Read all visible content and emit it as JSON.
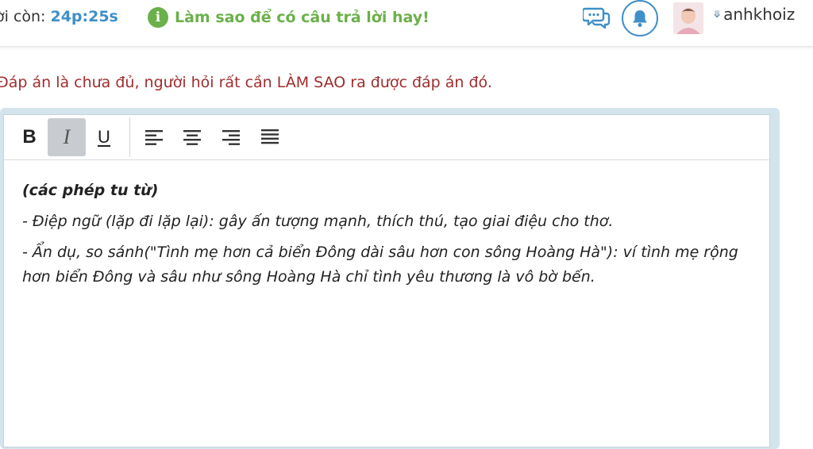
{
  "header": {
    "timer_label": "ời còn:",
    "timer_value": "24p:25s",
    "tip_icon": "info-icon",
    "tip_text": "Làm sao để có câu trả lời hay!",
    "icons": [
      "chat-icon",
      "bell-icon"
    ],
    "username": "anhkhoiz",
    "user_menu_icon": "double-chevron-down-icon"
  },
  "hint": "Đáp án là chưa đủ, người hỏi rất cần LÀM SAO ra được đáp án đó.",
  "toolbar": {
    "bold": "B",
    "italic": "I",
    "underline": "U",
    "align_icons": [
      "align-left-icon",
      "align-center-icon",
      "align-right-icon",
      "align-justify-icon"
    ],
    "active_button": "italic"
  },
  "editor": {
    "heading": "(các phép tu từ)",
    "lines": [
      "- Điệp ngữ (lặp đi lặp lại): gây ấn tượng mạnh, thích thú, tạo giai điệu cho thơ.",
      "- Ẩn dụ, so sánh(\"Tình mẹ hơn cả biển Đông dài sâu hơn con sông Hoàng Hà\"): ví tình mẹ rộng hơn biển Đông và sâu như sông Hoàng Hà chỉ tình yêu thương là vô bờ bến."
    ]
  },
  "colors": {
    "accent_blue": "#3f8fc8",
    "tip_green": "#6bb04a",
    "hint_red": "#a02d2d",
    "editor_frame": "#d3e4ec"
  }
}
